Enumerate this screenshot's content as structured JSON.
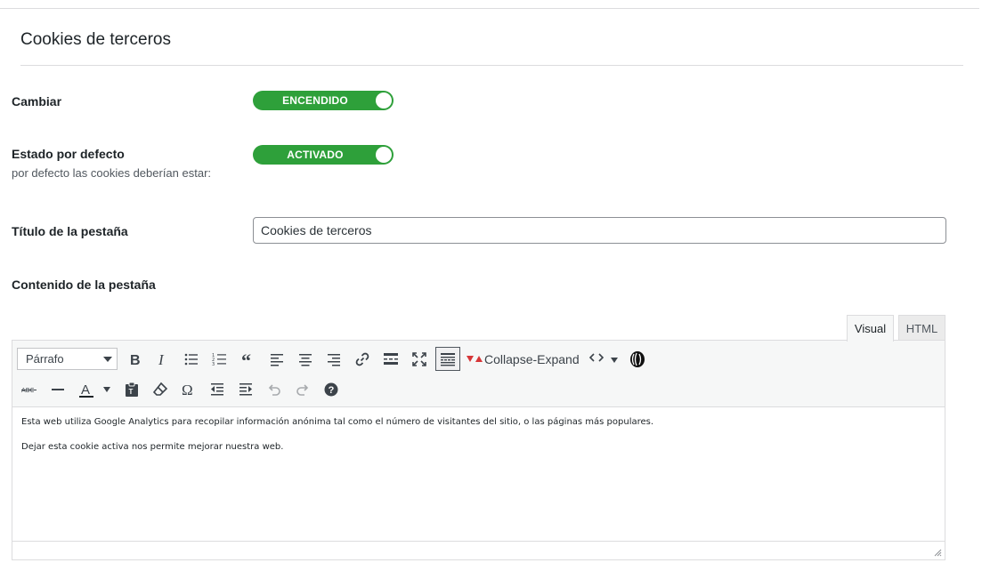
{
  "section": {
    "title": "Cookies de terceros"
  },
  "fields": {
    "switch": {
      "label": "Cambiar",
      "toggle_text": "ENCENDIDO"
    },
    "default_state": {
      "label": "Estado por defecto",
      "description": "por defecto las cookies deberían estar:",
      "toggle_text": "ACTIVADO"
    },
    "tab_title": {
      "label": "Título de la pestaña",
      "value": "Cookies de terceros"
    },
    "tab_content": {
      "label": "Contenido de la pestaña"
    }
  },
  "editor": {
    "tabs": {
      "visual": "Visual",
      "html": "HTML"
    },
    "format_select": "Párrafo",
    "collapse_expand": "Collapse-Expand",
    "icons": [
      "bold-icon",
      "italic-icon",
      "bullet-list-icon",
      "numbered-list-icon",
      "blockquote-icon",
      "align-left-icon",
      "align-center-icon",
      "align-right-icon",
      "link-icon",
      "read-more-icon",
      "fullscreen-icon",
      "toolbar-toggle-icon",
      "collapse-expand-icon",
      "code-icon",
      "plugin-icon",
      "strikethrough-icon",
      "horizontal-line-icon",
      "text-color-icon",
      "paste-text-icon",
      "clear-format-icon",
      "special-char-icon",
      "outdent-icon",
      "indent-icon",
      "undo-icon",
      "redo-icon",
      "help-icon"
    ],
    "content": {
      "paragraph1": "Esta web utiliza Google Analytics para recopilar información anónima tal como el número de visitantes del sitio, o las páginas más populares.",
      "paragraph2": "Dejar esta cookie activa nos permite mejorar nuestra web."
    }
  },
  "colors": {
    "toggle_on": "#2ea03a",
    "accent_red": "#d63638"
  }
}
